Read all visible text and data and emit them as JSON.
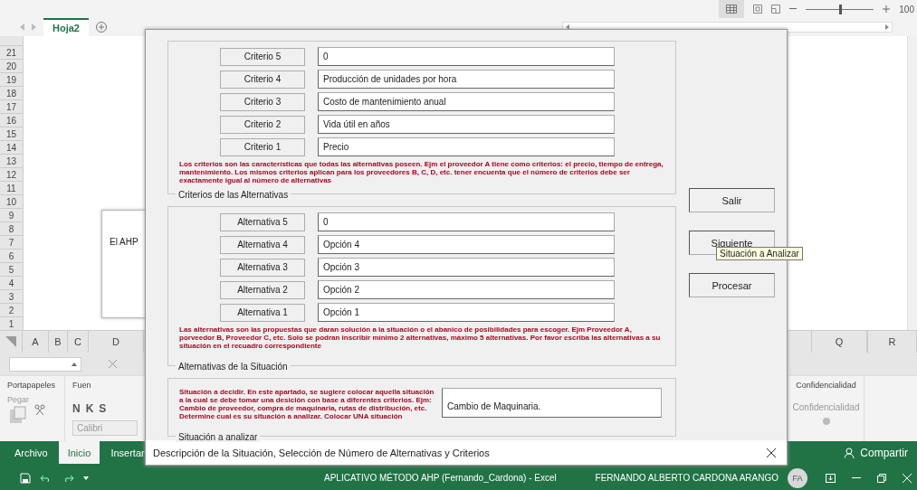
{
  "zoom": {
    "level": 0.5,
    "label": "100"
  },
  "sheets": [
    {
      "label": "Hoja2",
      "selected": true
    }
  ],
  "rows": [
    "21",
    "20",
    "19",
    "18",
    "17",
    "16",
    "15",
    "14",
    "13",
    "12",
    "11",
    "10",
    "9",
    "8",
    "7",
    "6",
    "5",
    "4",
    "3",
    "2",
    "1"
  ],
  "shape_text": "El AHP",
  "columns_left": [
    "A",
    "B",
    "C",
    "D"
  ],
  "columns_right": [
    "Q",
    "R"
  ],
  "ribbon": {
    "clipboard": {
      "label": "Portapapeles",
      "paste": "Pegar"
    },
    "font": {
      "label": "Fuen",
      "styles": [
        "N",
        "K",
        "S"
      ],
      "name": "Calibri"
    },
    "sensitivity": {
      "label": "Confidencialidad",
      "button": "Confidencialidad"
    }
  },
  "ribbon_tabs": [
    {
      "label": "Archivo",
      "selected": false
    },
    {
      "label": "Inicio",
      "selected": true
    },
    {
      "label": "Insertar",
      "selected": false
    }
  ],
  "share": "Compartir",
  "title_bar": {
    "title": "APLICATIVO MÉTODO AHP (Fernando_Cardona)  -  Excel",
    "user": "FERNANDO ALBERTO CARDONA ARANGO",
    "avatar": "FA"
  },
  "dialog": {
    "criteria": {
      "rows": [
        {
          "label": "Criterio 5",
          "value": "0"
        },
        {
          "label": "Criterio 4",
          "value": "Producción de unidades por hora"
        },
        {
          "label": "Criterio 3",
          "value": "Costo de mantenimiento anual"
        },
        {
          "label": "Criterio 2",
          "value": "Vida útil en años"
        },
        {
          "label": "Criterio 1",
          "value": "Precio"
        }
      ],
      "help": "Los criterios son las características que todas las alternativas poseen. Ejm el proveedor A tiene como criterios: el precio, tiempo de entrega, mantenimiento. Los mismos criterios aplican para los proveedores B, C, D, etc. tener encuenta que el número de criterios debe ser exactamente igual al número de alternativas",
      "legend": "Criterios de las Alternativas"
    },
    "alternatives": {
      "rows": [
        {
          "label": "Alternativa 5",
          "value": "0"
        },
        {
          "label": "Alternativa 4",
          "value": "Opción 4"
        },
        {
          "label": "Alternativa 3",
          "value": "Opción 3"
        },
        {
          "label": "Alternativa 2",
          "value": "Opción 2"
        },
        {
          "label": "Alternativa 1",
          "value": "Opción 1"
        }
      ],
      "help": "Las alternativas son las propuestas que daran solución a la situación o el abanico de posibilidades para escoger. Ejm Proveedor A, porveedor B, Proveedor C, etc. Solo se podran inscribir mínimo 2 alternativas, máximo 5 alternativas. Por favor escriba las alternativas a su situación en el recuadro correspondiente",
      "legend": "Alternativas de la Situación"
    },
    "situation": {
      "help": "Situación a decidir. En este apartado, se sugiere colocar aquella situación a la cual se debe tomar una desición con base a diferentes criterios. Ejm: Cambio de proveedor, compra de maquinaria, rutas de distribución, etc. Determine cual es su situación a analizar. Colocar UNA situación",
      "value": "Cambio de Maquinaria.",
      "legend": "Situación a analizar"
    },
    "buttons": [
      "Salir",
      "Siguiente",
      "Procesar"
    ],
    "tooltip": "Situación a Analizar",
    "title": "Descripción de la Situación, Selección de Número de Alternativas y Criterios"
  }
}
